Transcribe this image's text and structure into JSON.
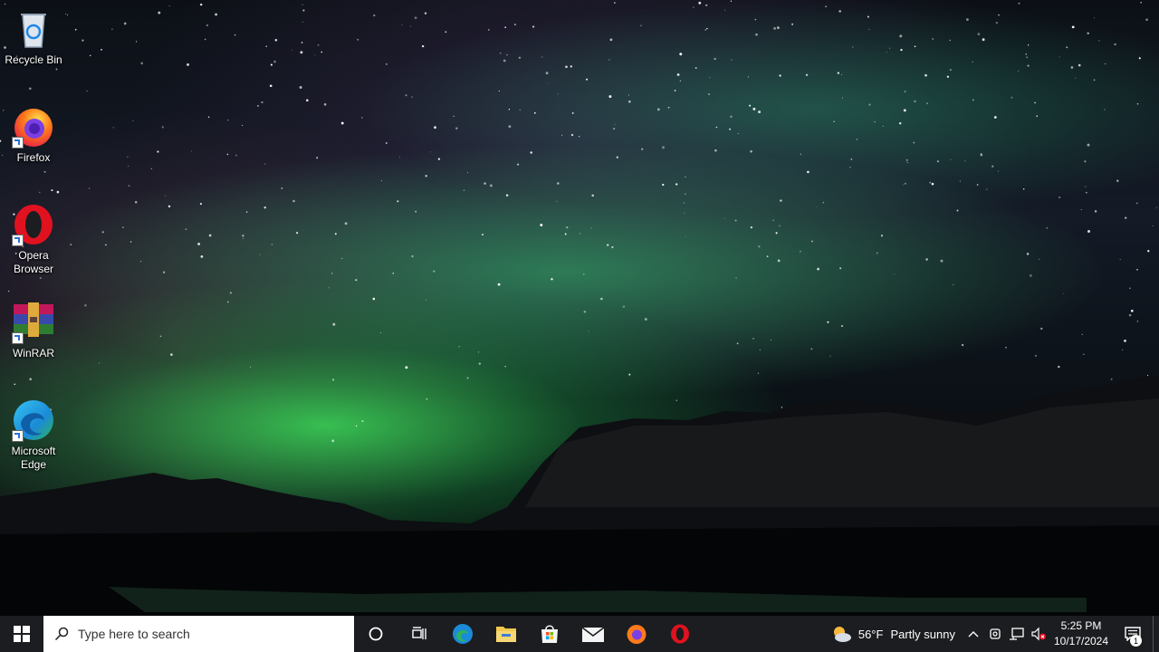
{
  "desktop": {
    "icons": [
      {
        "label_lines": [
          "Recycle Bin"
        ],
        "icon": "recycle-bin-icon"
      },
      {
        "label_lines": [
          "Firefox"
        ],
        "icon": "firefox-icon"
      },
      {
        "label_lines": [
          "Opera",
          "Browser"
        ],
        "icon": "opera-icon"
      },
      {
        "label_lines": [
          "WinRAR"
        ],
        "icon": "winrar-icon"
      },
      {
        "label_lines": [
          "Microsoft",
          "Edge"
        ],
        "icon": "edge-icon"
      }
    ]
  },
  "taskbar": {
    "start_icon": "windows-logo-icon",
    "search": {
      "placeholder": "Type here to search",
      "icon": "search-icon"
    },
    "pinned": [
      "cortana-icon",
      "task-view-icon",
      "edge-icon",
      "file-explorer-icon",
      "microsoft-store-icon",
      "mail-icon",
      "firefox-icon",
      "opera-icon"
    ],
    "weather": {
      "temp": "56°F",
      "condition": "Partly sunny",
      "icon": "partly-sunny-icon"
    },
    "tray_icons": [
      "chevron-up-icon",
      "meet-now-icon",
      "network-icon",
      "volume-muted-icon"
    ],
    "clock": {
      "time": "5:25 PM",
      "date": "10/17/2024"
    },
    "notifications": {
      "count": "1",
      "icon": "action-center-icon"
    }
  },
  "colors": {
    "taskbar_bg": "#1c1d20",
    "aurora_green": "#3cdc5a",
    "accent_blue": "#0078d7"
  }
}
